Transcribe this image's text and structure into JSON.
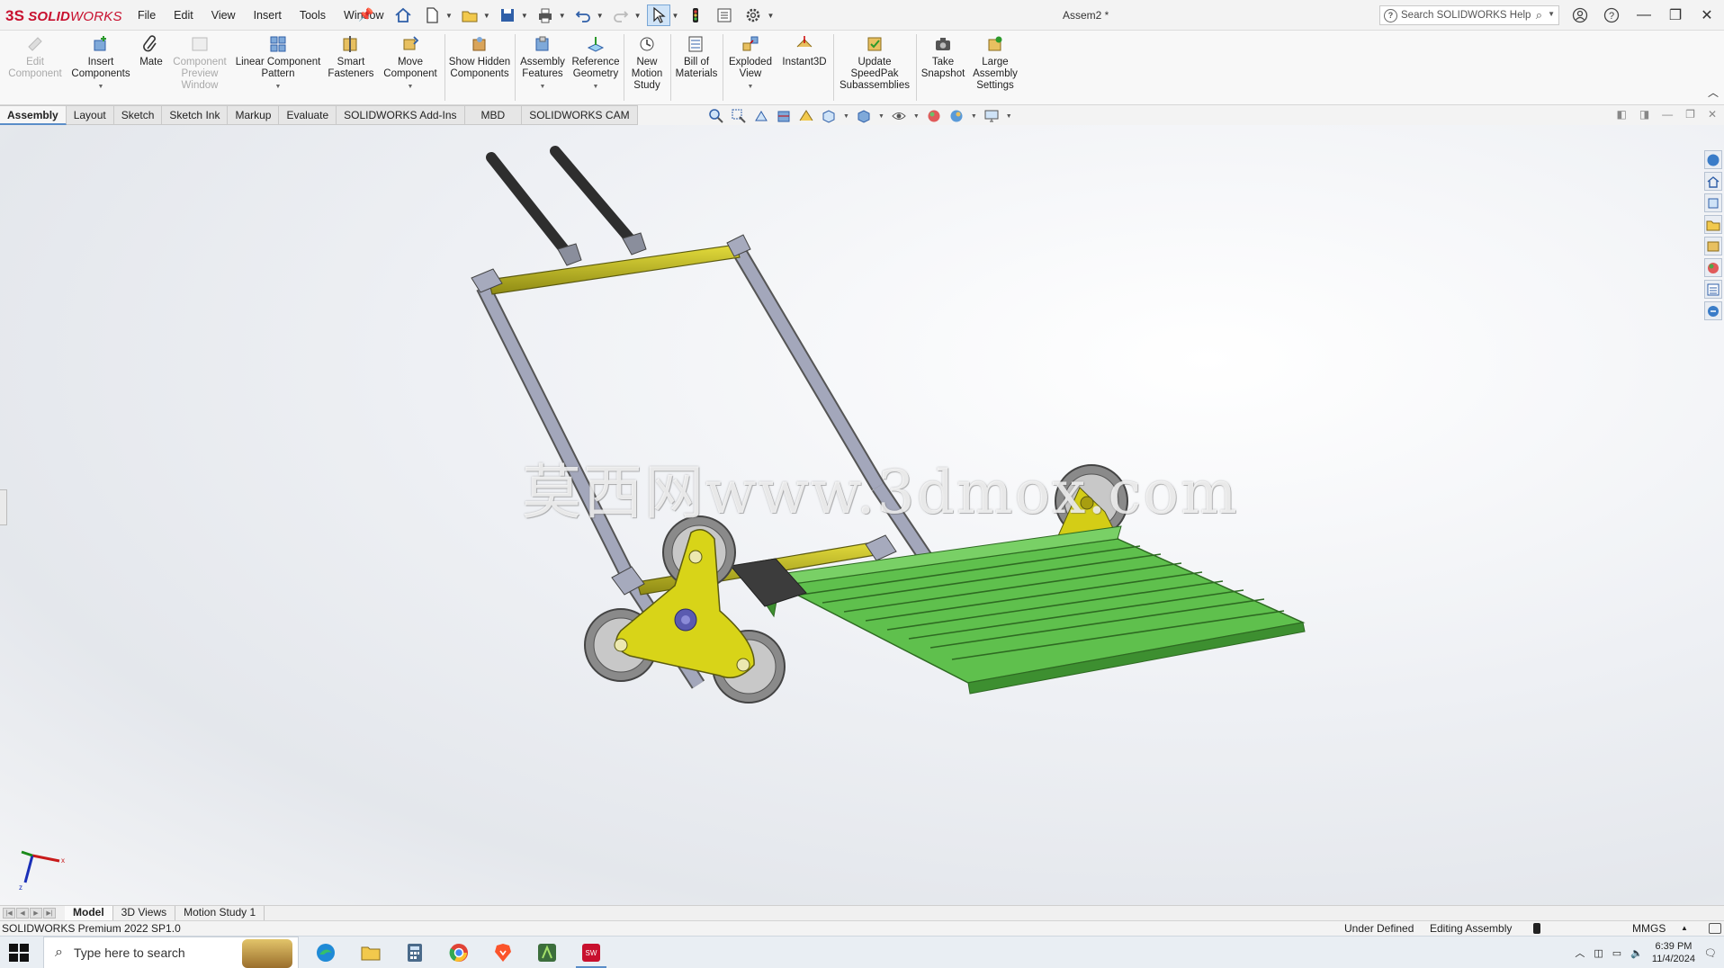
{
  "app": {
    "logo_ds": "3S",
    "logo_solid": "SOLID",
    "logo_works": "WORKS",
    "menus": [
      "File",
      "Edit",
      "View",
      "Insert",
      "Tools",
      "Window"
    ],
    "document_title": "Assem2 *",
    "search_placeholder": "Search SOLIDWORKS Help"
  },
  "command_manager": {
    "commands": [
      {
        "label": "Edit Component",
        "enabled": false
      },
      {
        "label": "Insert Components",
        "enabled": true
      },
      {
        "label": "Mate",
        "enabled": true
      },
      {
        "label": "Component Preview Window",
        "enabled": false
      },
      {
        "label": "Linear Component Pattern",
        "enabled": true
      },
      {
        "label": "Smart Fasteners",
        "enabled": true
      },
      {
        "label": "Move Component",
        "enabled": true
      },
      {
        "label": "Show Hidden Components",
        "enabled": true
      },
      {
        "label": "Assembly Features",
        "enabled": true
      },
      {
        "label": "Reference Geometry",
        "enabled": true
      },
      {
        "label": "New Motion Study",
        "enabled": true
      },
      {
        "label": "Bill of Materials",
        "enabled": true
      },
      {
        "label": "Exploded View",
        "enabled": true
      },
      {
        "label": "Instant3D",
        "enabled": true
      },
      {
        "label": "Update SpeedPak Subassemblies",
        "enabled": true
      },
      {
        "label": "Take Snapshot",
        "enabled": true
      },
      {
        "label": "Large Assembly Settings",
        "enabled": true
      }
    ]
  },
  "tabs": [
    "Assembly",
    "Layout",
    "Sketch",
    "Sketch Ink",
    "Markup",
    "Evaluate",
    "SOLIDWORKS Add-Ins",
    "MBD",
    "SOLIDWORKS CAM"
  ],
  "active_tab": "Assembly",
  "watermark": "莫西网www.3dmox.com",
  "triad": {
    "x": "x",
    "y": "y",
    "z": "z"
  },
  "bottom_tabs": [
    "Model",
    "3D Views",
    "Motion Study 1"
  ],
  "status": {
    "product": "SOLIDWORKS Premium 2022 SP1.0",
    "definition": "Under Defined",
    "mode": "Editing Assembly",
    "units": "MMGS"
  },
  "taskbar": {
    "search_placeholder": "Type here to search",
    "time": "6:39 PM",
    "date": "11/4/2024"
  },
  "colors": {
    "brand": "#c8102e",
    "frame_tube": "#9ca0b4",
    "crossbar": "#c8c21c",
    "platform": "#58b848",
    "wheel": "#b8b8b8",
    "plate": "#d8d414",
    "bracket": "#4a4a4a"
  }
}
